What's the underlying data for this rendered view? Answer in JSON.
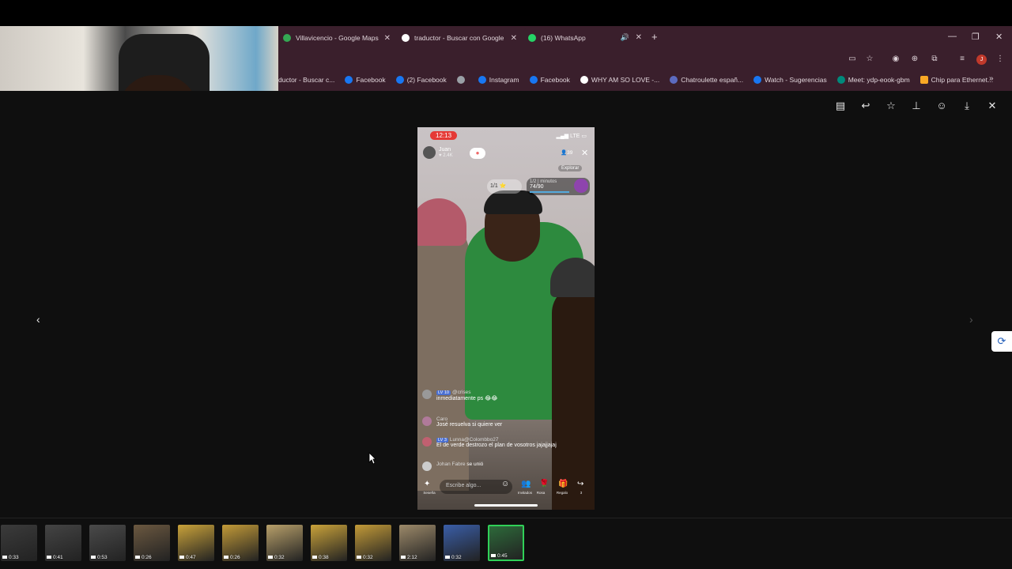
{
  "browser": {
    "tabs": [
      {
        "title": "Villavicencio - Google Maps",
        "icon": "maps-icon",
        "color": "#34a853"
      },
      {
        "title": "traductor - Buscar con Google",
        "icon": "google-icon",
        "color": "#ffffff"
      },
      {
        "title": "(16) WhatsApp",
        "icon": "whatsapp-icon",
        "color": "#25d366"
      }
    ],
    "new_tab": "+",
    "bookmarks": [
      {
        "label": "ductor - Buscar c...",
        "color": "#ffffff"
      },
      {
        "label": "Facebook",
        "color": "#1877f2"
      },
      {
        "label": "(2) Facebook",
        "color": "#1877f2"
      },
      {
        "label": "",
        "color": "#9aa0a6"
      },
      {
        "label": "Instagram",
        "color": "#1877f2"
      },
      {
        "label": "Facebook",
        "color": "#1877f2"
      },
      {
        "label": "WHY AM SO LOVE -...",
        "color": "#ffffff"
      },
      {
        "label": "Chatroulette españ...",
        "color": "#5c6bc0"
      },
      {
        "label": "Watch - Sugerencias",
        "color": "#1877f2"
      },
      {
        "label": "Meet: ydp-eook-gbm",
        "color": "#00897b"
      },
      {
        "label": "Chip para Ethernet...",
        "color": "#f9a825"
      }
    ],
    "profile_initial": "J"
  },
  "phone": {
    "time": "12:13",
    "status": "LTE",
    "host_name": "Juan",
    "host_likes": "2.4K",
    "viewers": "39",
    "explorar": "Explorar",
    "star_label": "1/1",
    "goal_label": "1/2 | minutos",
    "goal_progress": "74/90",
    "chat": [
      {
        "user": "@crises",
        "level": "LV 10",
        "msg": "inmediatamente ps 😂😂"
      },
      {
        "user": "Caro",
        "level": "",
        "msg": "José resuelva si quiere ver"
      },
      {
        "user": "Lunna@Colombbo27",
        "level": "LV 3",
        "msg": "El de verde destrozo el plan de vosotros jajajjajaj"
      },
      {
        "user": "Johan Fabre",
        "level": "",
        "msg": "se unió"
      }
    ],
    "input_placeholder": "Escribe algo...",
    "bottom_labels": [
      "Seseña",
      "Invitados",
      "Rosa",
      "Regalo",
      "3"
    ]
  },
  "filmstrip": [
    {
      "dur": "0:33",
      "color": "#3b3b3b"
    },
    {
      "dur": "0:41",
      "color": "#444"
    },
    {
      "dur": "0:53",
      "color": "#4a4a4a"
    },
    {
      "dur": "0:26",
      "color": "#6b5840"
    },
    {
      "dur": "0:47",
      "color": "#c9a23a"
    },
    {
      "dur": "0:26",
      "color": "#c29a38"
    },
    {
      "dur": "0:32",
      "color": "#b8a06a"
    },
    {
      "dur": "0:38",
      "color": "#c9a23a"
    },
    {
      "dur": "0:32",
      "color": "#c29a38"
    },
    {
      "dur": "2:12",
      "color": "#9d8a6a"
    },
    {
      "dur": "0:32",
      "color": "#3a5ea8"
    },
    {
      "dur": "0:45",
      "color": "#2d6a3a"
    }
  ]
}
